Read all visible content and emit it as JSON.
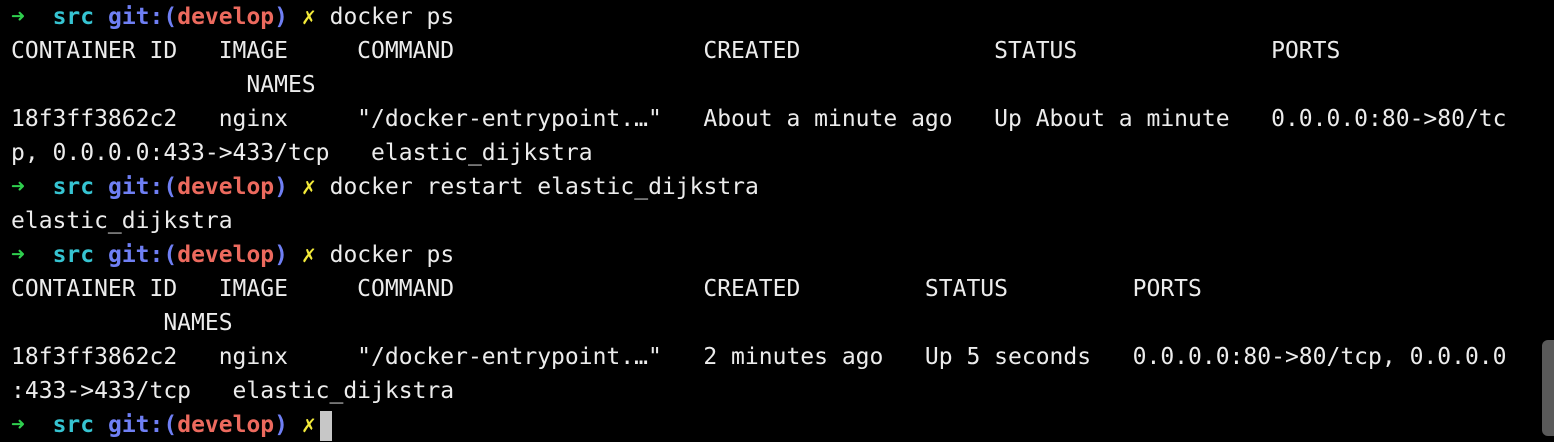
{
  "prompt": {
    "arrow": "➜",
    "dir": "src",
    "git_prefix": "git:(",
    "branch": "develop",
    "git_suffix": ")",
    "dirty": "✗"
  },
  "lines": [
    {
      "type": "prompt",
      "cmd": "docker ps"
    },
    {
      "type": "output",
      "text": "CONTAINER ID   IMAGE     COMMAND                  CREATED              STATUS              PORTS"
    },
    {
      "type": "output",
      "text": "                 NAMES"
    },
    {
      "type": "output",
      "text": "18f3ff3862c2   nginx     \"/docker-entrypoint.…\"   About a minute ago   Up About a minute   0.0.0.0:80->80/tc"
    },
    {
      "type": "output",
      "text": "p, 0.0.0.0:433->433/tcp   elastic_dijkstra"
    },
    {
      "type": "prompt",
      "cmd": "docker restart elastic_dijkstra"
    },
    {
      "type": "output",
      "text": "elastic_dijkstra"
    },
    {
      "type": "prompt",
      "cmd": "docker ps"
    },
    {
      "type": "output",
      "text": "CONTAINER ID   IMAGE     COMMAND                  CREATED         STATUS         PORTS"
    },
    {
      "type": "output",
      "text": "           NAMES"
    },
    {
      "type": "output",
      "text": "18f3ff3862c2   nginx     \"/docker-entrypoint.…\"   2 minutes ago   Up 5 seconds   0.0.0.0:80->80/tcp, 0.0.0.0"
    },
    {
      "type": "output",
      "text": ":433->433/tcp   elastic_dijkstra"
    },
    {
      "type": "prompt",
      "cmd": ""
    }
  ],
  "colors": {
    "background": "#000000",
    "text": "#ececec",
    "arrow": "#2fcf4e",
    "dir": "#36c4d2",
    "git": "#6f7ff4",
    "branch": "#ec6a5e",
    "dirty": "#f3ea3a",
    "cursor": "#c7c7c7"
  }
}
